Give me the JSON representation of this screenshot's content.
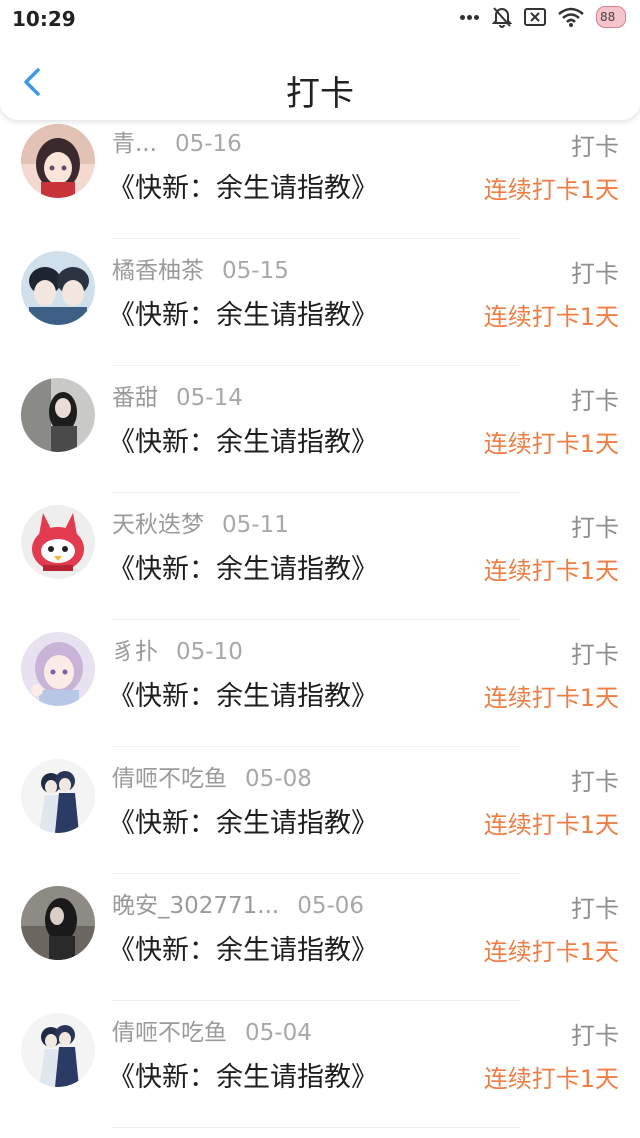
{
  "status_bar": {
    "time": "10:29",
    "battery": "88",
    "icons": [
      "more-dots-icon",
      "mute-bell-icon",
      "sim-x-icon",
      "wifi-icon",
      "battery-icon"
    ]
  },
  "header": {
    "title": "打卡",
    "back_icon": "chevron-left-icon"
  },
  "colors": {
    "accent_back": "#3b9bea",
    "streak": "#ef7d44",
    "meta": "#9a9a9a",
    "book": "#1e1e1e"
  },
  "checkins": [
    {
      "user": "青...",
      "date": "05-16",
      "book": "《快新：余生请指教》",
      "action": "打卡",
      "streak": "连续打卡1天"
    },
    {
      "user": "橘香柚茶",
      "date": "05-15",
      "book": "《快新：余生请指教》",
      "action": "打卡",
      "streak": "连续打卡1天"
    },
    {
      "user": "番甜",
      "date": "05-14",
      "book": "《快新：余生请指教》",
      "action": "打卡",
      "streak": "连续打卡1天"
    },
    {
      "user": "天秋迭梦",
      "date": "05-11",
      "book": "《快新：余生请指教》",
      "action": "打卡",
      "streak": "连续打卡1天"
    },
    {
      "user": "豸扑",
      "date": "05-10",
      "book": "《快新：余生请指教》",
      "action": "打卡",
      "streak": "连续打卡1天"
    },
    {
      "user": "倩咂不吃鱼",
      "date": "05-08",
      "book": "《快新：余生请指教》",
      "action": "打卡",
      "streak": "连续打卡1天"
    },
    {
      "user": "晚安_302771...",
      "date": "05-06",
      "book": "《快新：余生请指教》",
      "action": "打卡",
      "streak": "连续打卡1天"
    },
    {
      "user": "倩咂不吃鱼",
      "date": "05-04",
      "book": "《快新：余生请指教》",
      "action": "打卡",
      "streak": "连续打卡1天"
    }
  ]
}
